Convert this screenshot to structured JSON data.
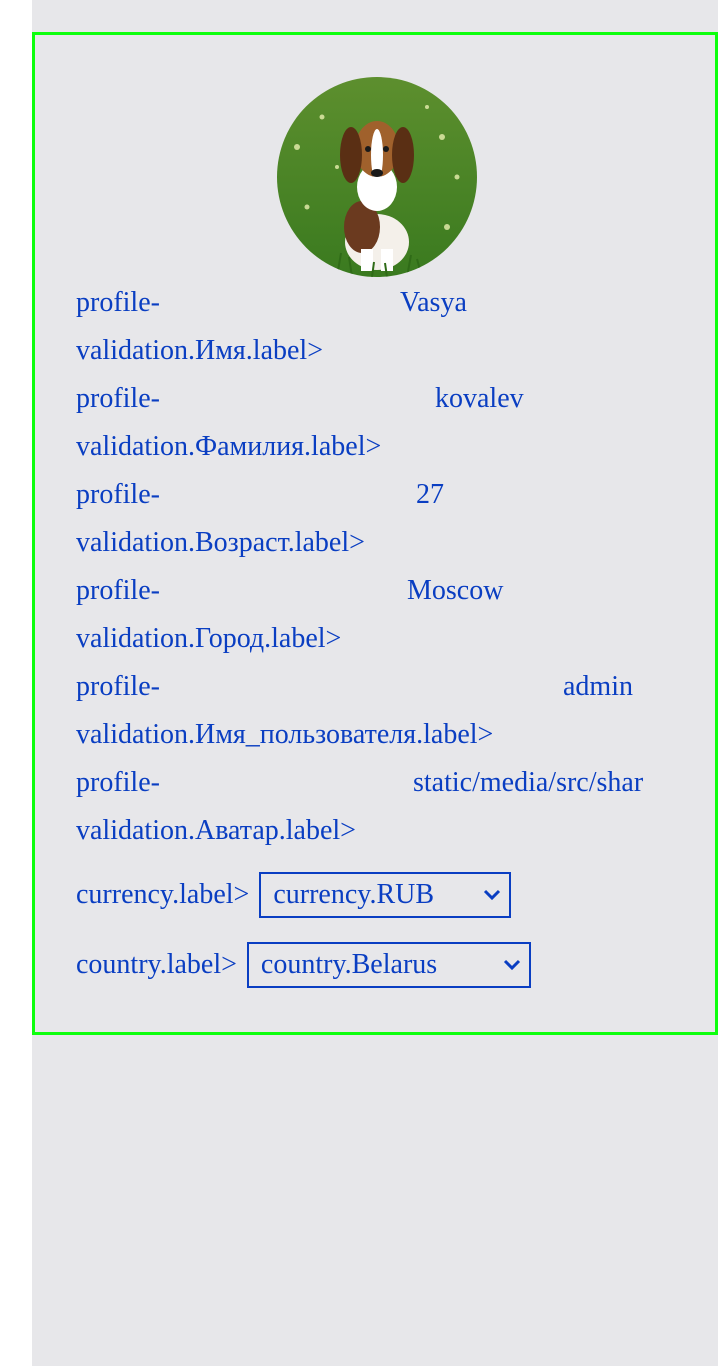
{
  "profile": {
    "avatar_alt": "beagle puppy avatar",
    "fields": [
      {
        "label": "profile-validation.Имя.label>",
        "label_line1": "profile-",
        "label_line2": "validation.Имя.label>",
        "value": "Vasya"
      },
      {
        "label": "profile-validation.Фамилия.label>",
        "label_line1": "profile-",
        "label_line2": "validation.Фамилия.label>",
        "value": "kovalev"
      },
      {
        "label": "profile-validation.Возраст.label>",
        "label_line1": "profile-",
        "label_line2": "validation.Возраст.label>",
        "value": "27"
      },
      {
        "label": "profile-validation.Город.label>",
        "label_line1": "profile-",
        "label_line2": "validation.Город.label>",
        "value": "Moscow"
      },
      {
        "label": "profile-validation.Имя_пользователя.label>",
        "label_line1": "profile-",
        "label_line2": "validation.Имя_пользователя.label>",
        "value": "admin"
      },
      {
        "label": "profile-validation.Аватар.label>",
        "label_line1": "profile-",
        "label_line2": "validation.Аватар.label>",
        "value": "static/media/src/shar"
      }
    ],
    "currency": {
      "label": "currency.label>",
      "selected": "currency.RUB"
    },
    "country": {
      "label": "country.label>",
      "selected": "country.Belarus"
    }
  },
  "colors": {
    "text": "#0a3ec2",
    "border": "#0dff0d",
    "background": "#e7e7ea"
  }
}
